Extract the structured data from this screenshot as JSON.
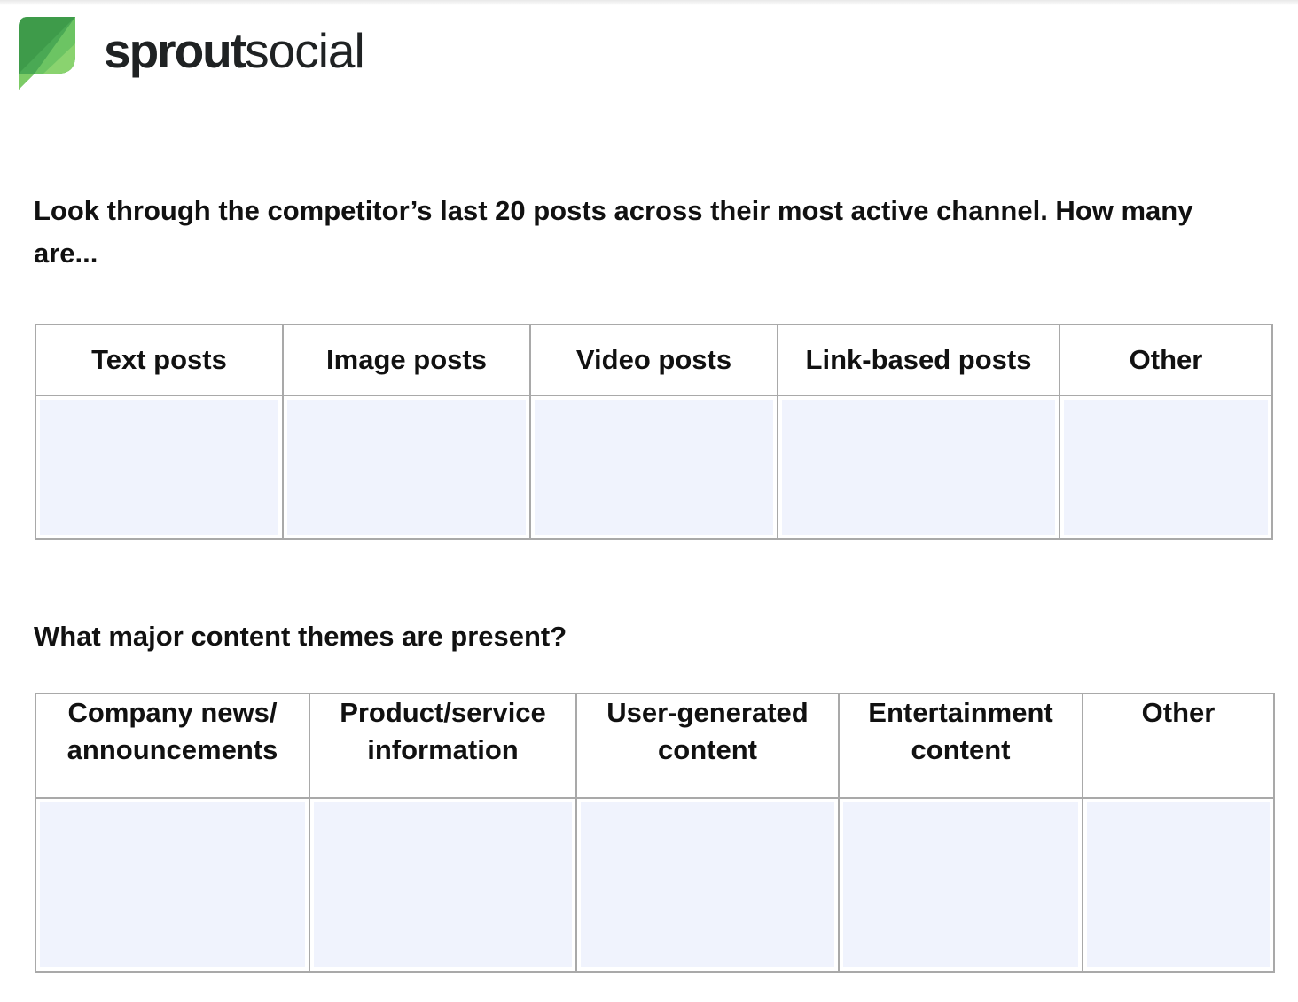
{
  "brand": {
    "logo_icon": "sprout-leaf-icon",
    "wordmark_bold": "sprout",
    "wordmark_light": "social",
    "colors": {
      "leaf_dark": "#3e9b4a",
      "leaf_mid": "#59b55a",
      "leaf_light": "#8ad36f",
      "wordmark": "#1f2223"
    }
  },
  "section1": {
    "question": "Look through the competitor’s last 20 posts across their most active channel. How many are...",
    "columns": [
      "Text posts",
      "Image posts",
      "Video posts",
      "Link-based posts",
      "Other"
    ],
    "answers": [
      "",
      "",
      "",
      "",
      ""
    ]
  },
  "section2": {
    "question": "What major content themes are present?",
    "columns": [
      "Company news/ announcements",
      "Product/service information",
      "User-generated content",
      "Entertainment content",
      "Other"
    ],
    "answers": [
      "",
      "",
      "",
      "",
      ""
    ]
  },
  "colors": {
    "answer_fill": "#f0f3fd",
    "border": "#a9a9a9"
  }
}
